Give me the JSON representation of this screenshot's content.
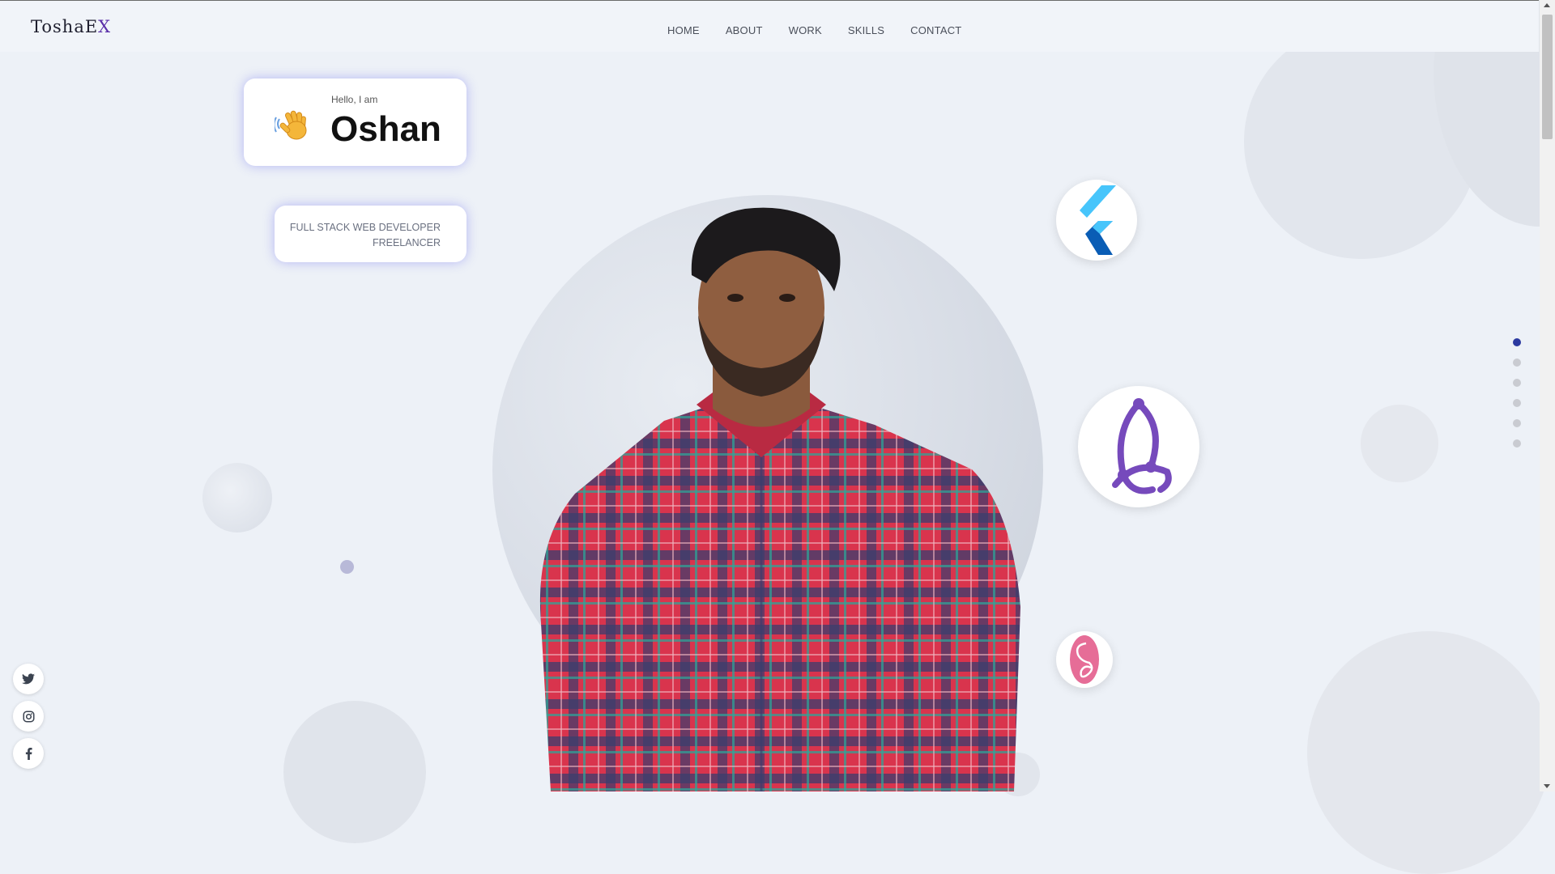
{
  "logo": {
    "main": "ToshaE",
    "accent": "X"
  },
  "nav": {
    "items": [
      {
        "label": "HOME"
      },
      {
        "label": "ABOUT"
      },
      {
        "label": "WORK"
      },
      {
        "label": "SKILLS"
      },
      {
        "label": "CONTACT"
      }
    ]
  },
  "hero": {
    "greeting": "Hello, I am",
    "name": "Oshan",
    "roles": [
      "FULL STACK WEB DEVELOPER",
      "FREELANCER"
    ]
  },
  "tech_badges": [
    {
      "icon": "flutter-icon"
    },
    {
      "icon": "redux-icon"
    },
    {
      "icon": "sass-icon"
    }
  ],
  "section_dots": {
    "count": 6,
    "active_index": 0
  },
  "socials": [
    {
      "icon": "twitter-icon"
    },
    {
      "icon": "instagram-icon"
    },
    {
      "icon": "facebook-icon"
    }
  ],
  "colors": {
    "background": "#edf1f7",
    "accent": "#5a2fa8",
    "active_dot": "#2c3aa0",
    "card_glow": "#6e6ef0"
  }
}
